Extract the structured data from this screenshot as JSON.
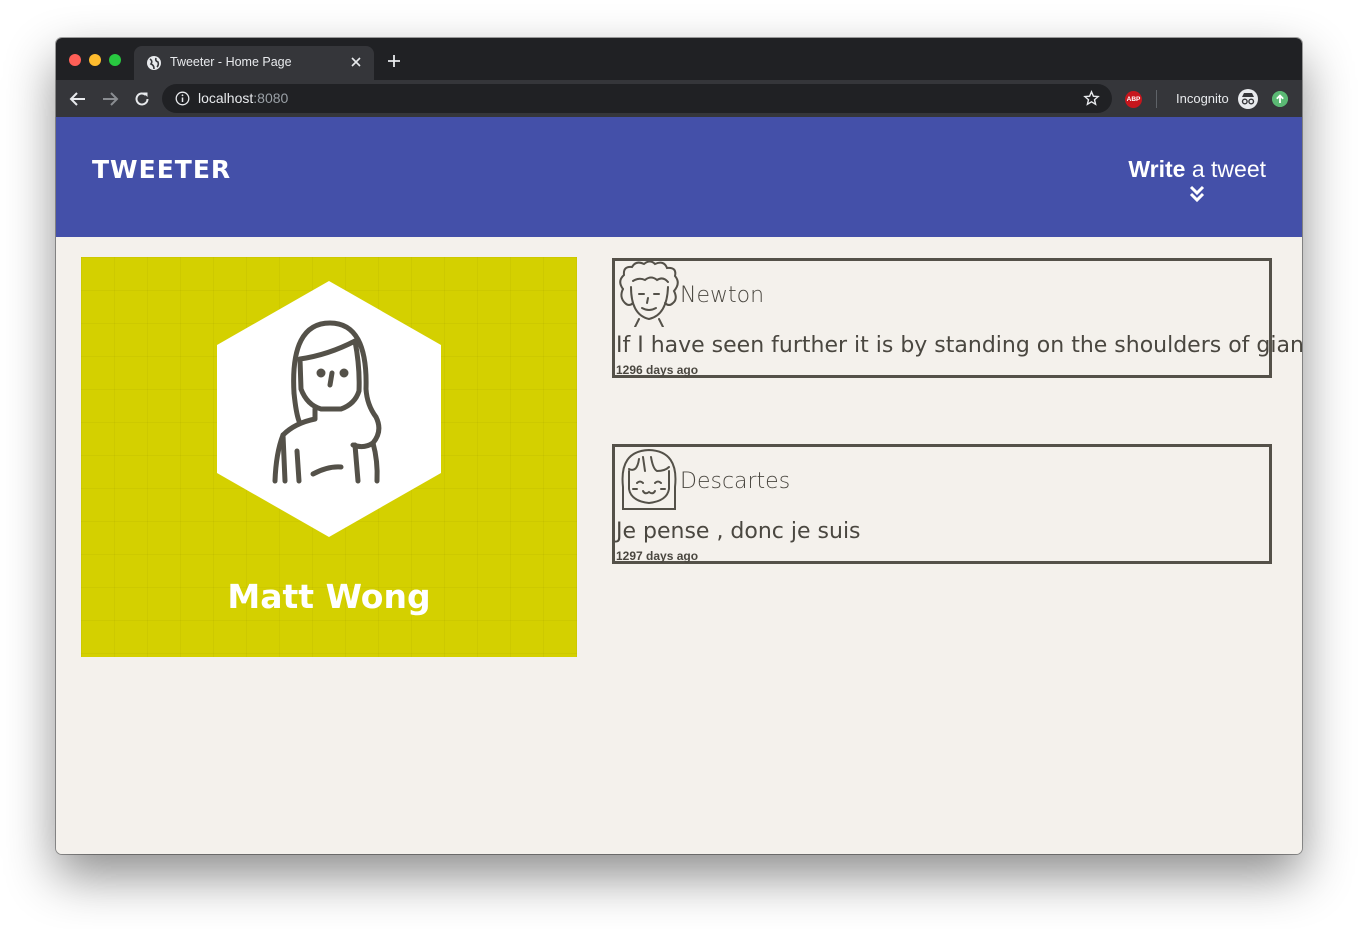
{
  "browser": {
    "tab_title": "Tweeter - Home Page",
    "url_host": "localhost",
    "url_port": ":8080",
    "abp_label": "ABP",
    "incognito_label": "Incognito"
  },
  "nav": {
    "brand": "TWEETER",
    "compose_bold": "Write",
    "compose_light": " a tweet"
  },
  "profile": {
    "name": "Matt Wong"
  },
  "tweets": [
    {
      "author": "Newton",
      "text": "If I have seen further it is by standing on the shoulders of giants",
      "time": "1296 days ago"
    },
    {
      "author": "Descartes",
      "text": "Je pense , donc je suis",
      "time": "1297 days ago"
    }
  ],
  "colors": {
    "header": "#4450a9",
    "profile_bg": "#d4d000",
    "page_bg": "#f4f1ec",
    "tweet_border": "#545149"
  }
}
